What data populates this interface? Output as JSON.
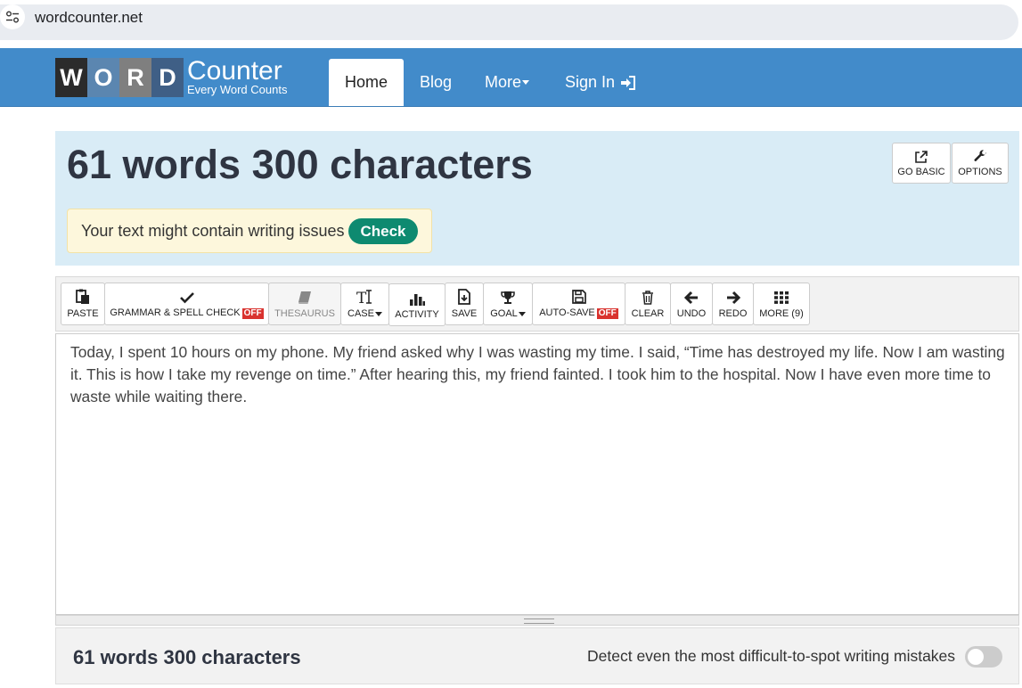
{
  "browser": {
    "url": "wordcounter.net"
  },
  "header": {
    "logo": {
      "tiles": [
        "W",
        "O",
        "R",
        "D"
      ],
      "tile_colors": [
        "#2b2b2b",
        "#5b86b0",
        "#7f7f7f",
        "#3f5f86"
      ],
      "name": "Counter",
      "tagline": "Every Word Counts"
    },
    "nav": {
      "home": "Home",
      "blog": "Blog",
      "more": "More",
      "sign_in": "Sign In"
    }
  },
  "stats_panel": {
    "headline": "61 words 300 characters",
    "go_basic": "GO BASIC",
    "options": "OPTIONS",
    "issues_text": "Your text might contain writing issues",
    "check_label": "Check"
  },
  "toolbar": {
    "paste": "PASTE",
    "grammar": "GRAMMAR & SPELL CHECK",
    "grammar_state": "OFF",
    "thesaurus": "THESAURUS",
    "case": "CASE",
    "activity": "ACTIVITY",
    "save": "SAVE",
    "goal": "GOAL",
    "autosave": "AUTO-SAVE",
    "autosave_state": "OFF",
    "clear": "CLEAR",
    "undo": "UNDO",
    "redo": "REDO",
    "more": "MORE (9)"
  },
  "editor": {
    "text": "Today, I spent 10 hours on my phone. My friend asked why I was wasting my time. I said, “Time has destroyed my life. Now I am wasting it. This is how I take my revenge on time.” After hearing this, my friend fainted. I took him to the hospital. Now I have even more time to waste while waiting there."
  },
  "footer": {
    "count": "61 words 300 characters",
    "detect_text": "Detect even the most difficult-to-spot writing mistakes",
    "toggle_on": false
  },
  "colors": {
    "nav_bg": "#428bca",
    "panel_bg": "#d9ecf6",
    "check_btn": "#0e8a70",
    "off_badge": "#d9322e"
  }
}
